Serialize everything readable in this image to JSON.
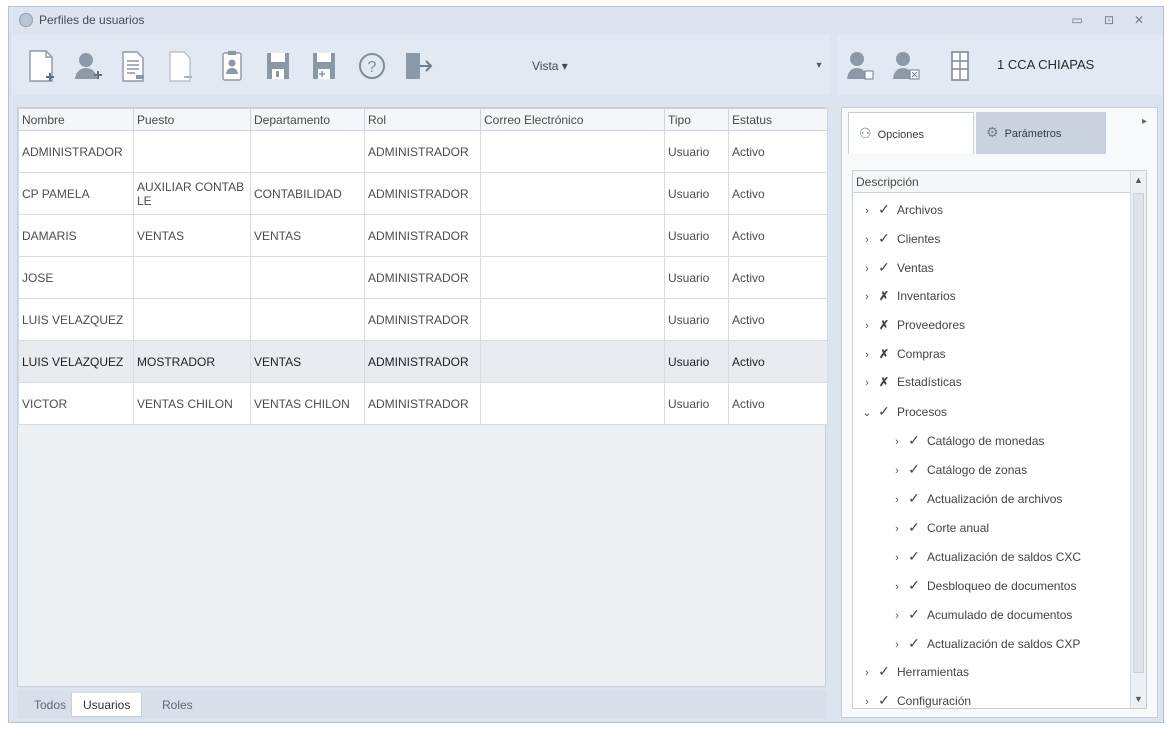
{
  "window": {
    "title": "Perfiles de usuarios"
  },
  "toolbar": {
    "vista_label": "Vista ▾"
  },
  "grid": {
    "columns": [
      "Nombre",
      "Puesto",
      "Departamento",
      "Rol",
      "Correo Electrónico",
      "Tipo",
      "Estatus"
    ],
    "rows": [
      [
        "ADMINISTRADOR",
        "",
        "",
        "ADMINISTRADOR",
        "",
        "Usuario",
        "Activo"
      ],
      [
        "CP PAMELA",
        "AUXILIAR CONTABLE",
        "CONTABILIDAD",
        "ADMINISTRADOR",
        "",
        "Usuario",
        "Activo"
      ],
      [
        "DAMARIS",
        "VENTAS",
        "VENTAS",
        "ADMINISTRADOR",
        "",
        "Usuario",
        "Activo"
      ],
      [
        "JOSE",
        "",
        "",
        "ADMINISTRADOR",
        "",
        "Usuario",
        "Activo"
      ],
      [
        "LUIS VELAZQUEZ",
        "",
        "",
        "ADMINISTRADOR",
        "",
        "Usuario",
        "Activo"
      ],
      [
        "LUIS VELAZQUEZ",
        "MOSTRADOR",
        "VENTAS",
        "ADMINISTRADOR",
        "",
        "Usuario",
        "Activo"
      ],
      [
        "VICTOR",
        "VENTAS CHILON",
        "VENTAS CHILON",
        "ADMINISTRADOR",
        "",
        "Usuario",
        "Activo"
      ]
    ]
  },
  "bottom_tabs": [
    "Todos",
    "Usuarios",
    "Roles"
  ],
  "branch": "1 CCA CHIAPAS",
  "right_tabs": {
    "options": "Opciones",
    "params": "Parámetros"
  },
  "tree": {
    "header": "Descripción",
    "items": [
      "Archivos",
      "Clientes",
      "Ventas",
      "Inventarios",
      "Proveedores",
      "Compras",
      "Estadísticas",
      "Procesos",
      "Catálogo de monedas",
      "Catálogo de zonas",
      "Actualización de archivos",
      "Corte anual",
      "Actualización de saldos CXC",
      "Desbloqueo de documentos",
      "Acumulado de documentos",
      "Actualización de saldos CXP",
      "Herramientas",
      "Configuración"
    ]
  }
}
